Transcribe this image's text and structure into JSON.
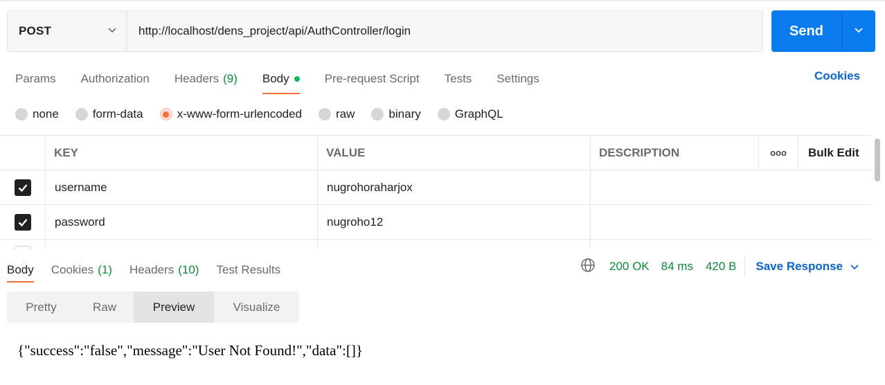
{
  "request": {
    "method": "POST",
    "url": "http://localhost/dens_project/api/AuthController/login",
    "send_label": "Send"
  },
  "request_tabs": [
    {
      "label": "Params",
      "count": ""
    },
    {
      "label": "Authorization",
      "count": ""
    },
    {
      "label": "Headers",
      "count": "(9)"
    },
    {
      "label": "Body",
      "count": ""
    },
    {
      "label": "Pre-request Script",
      "count": ""
    },
    {
      "label": "Tests",
      "count": ""
    },
    {
      "label": "Settings",
      "count": ""
    }
  ],
  "cookies_link": "Cookies",
  "body_types": [
    "none",
    "form-data",
    "x-www-form-urlencoded",
    "raw",
    "binary",
    "GraphQL"
  ],
  "selected_body_type": "x-www-form-urlencoded",
  "params_table": {
    "headers": {
      "key": "KEY",
      "value": "VALUE",
      "description": "DESCRIPTION",
      "more": "ooo",
      "bulk_edit": "Bulk Edit"
    },
    "rows": [
      {
        "checked": true,
        "key": "username",
        "value": "nugrohoraharjox",
        "description": ""
      },
      {
        "checked": true,
        "key": "password",
        "value": "nugroho12",
        "description": ""
      }
    ]
  },
  "response_tabs": [
    {
      "label": "Body",
      "count": ""
    },
    {
      "label": "Cookies",
      "count": "(1)"
    },
    {
      "label": "Headers",
      "count": "(10)"
    },
    {
      "label": "Test Results",
      "count": ""
    }
  ],
  "response_status": {
    "status": "200 OK",
    "time": "84 ms",
    "size": "420 B",
    "save_label": "Save Response"
  },
  "view_modes": [
    "Pretty",
    "Raw",
    "Preview",
    "Visualize"
  ],
  "selected_view": "Preview",
  "response_body": "{\"success\":\"false\",\"message\":\"User Not Found!\",\"data\":[]}",
  "colors": {
    "accent": "#ff6c37",
    "send": "#097bed",
    "status_green": "#0b8a38",
    "link_blue": "#0b64c9"
  }
}
